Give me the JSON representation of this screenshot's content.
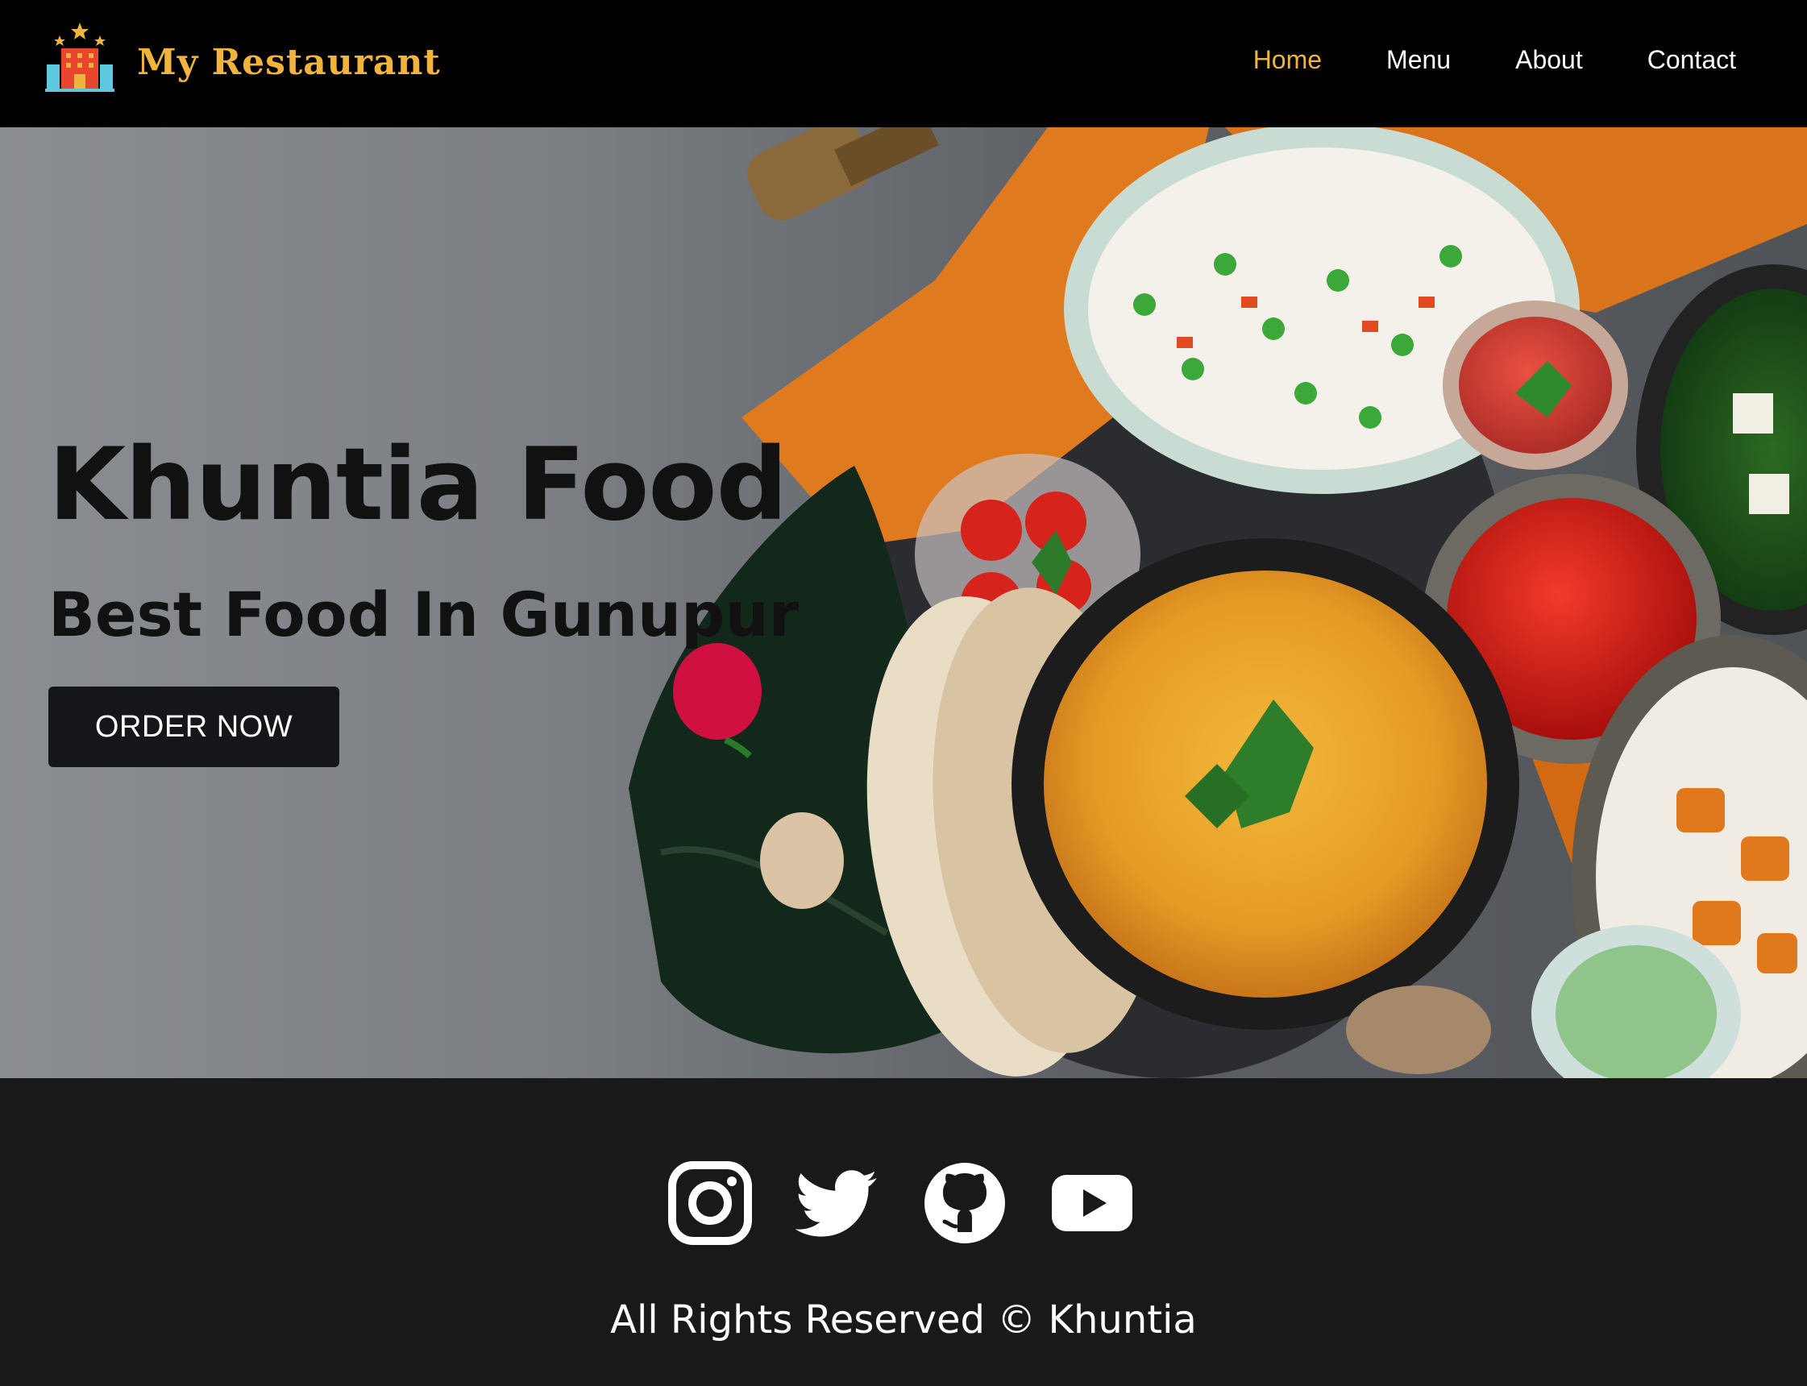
{
  "nav": {
    "brand": "My Restaurant",
    "links": [
      {
        "label": "Home",
        "active": true
      },
      {
        "label": "Menu",
        "active": false
      },
      {
        "label": "About",
        "active": false
      },
      {
        "label": "Contact",
        "active": false
      }
    ]
  },
  "hero": {
    "title": "Khuntia Food",
    "subtitle": "Best Food In Gunupur",
    "cta_label": "ORDER NOW"
  },
  "footer": {
    "social_icons": [
      "instagram-icon",
      "twitter-icon",
      "github-icon",
      "youtube-icon"
    ],
    "copyright": "All Rights Reserved © Khuntia"
  },
  "colors": {
    "navbar_bg": "#000000",
    "accent": "#f0b43c",
    "footer_bg": "#191919",
    "button_bg": "#141619"
  }
}
